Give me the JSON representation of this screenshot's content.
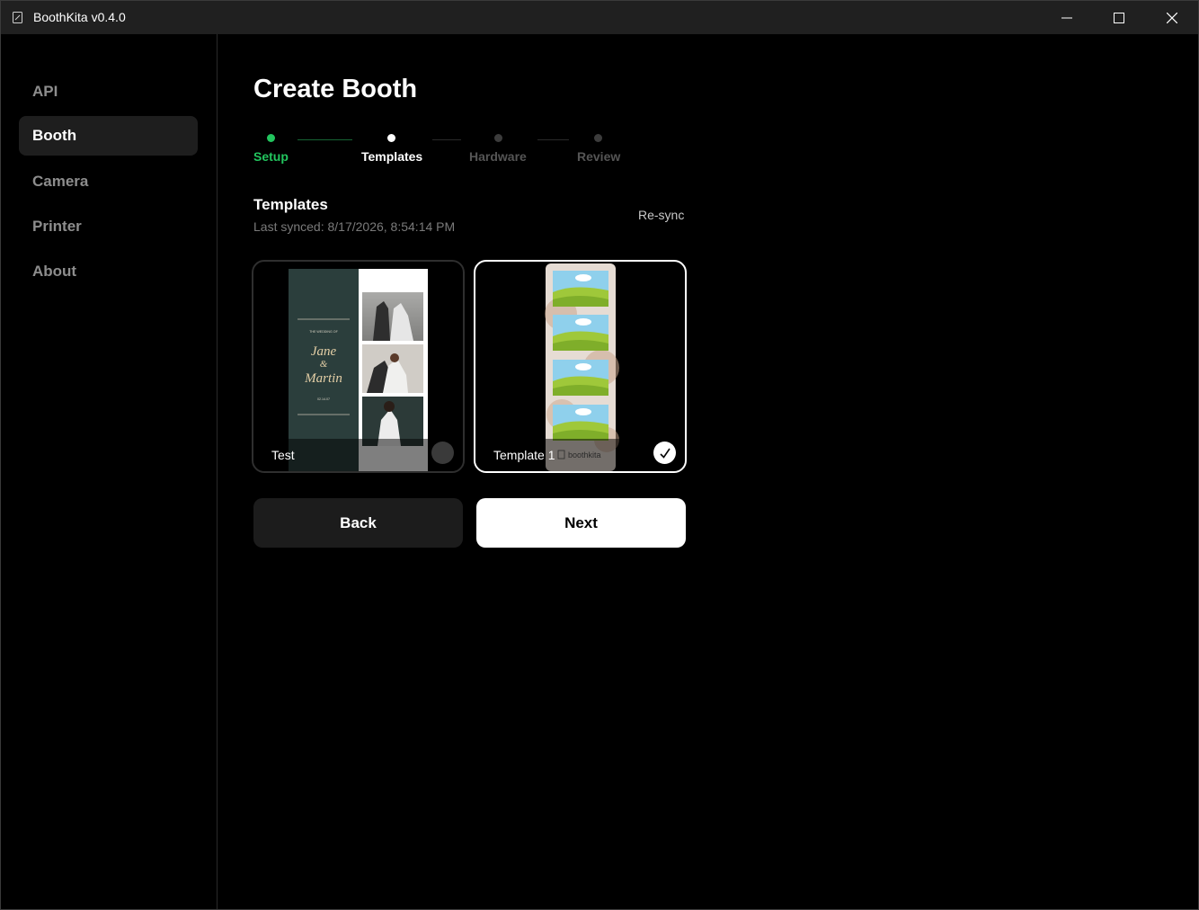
{
  "window": {
    "title": "BoothKita v0.4.0",
    "controls": [
      "minimize-icon",
      "maximize-icon",
      "close-icon"
    ]
  },
  "sidebar": {
    "items": [
      {
        "label": "API",
        "active": false
      },
      {
        "label": "Booth",
        "active": true
      },
      {
        "label": "Camera",
        "active": false
      },
      {
        "label": "Printer",
        "active": false
      },
      {
        "label": "About",
        "active": false
      }
    ]
  },
  "page": {
    "title": "Create Booth"
  },
  "stepper": {
    "steps": [
      {
        "label": "Setup",
        "state": "complete"
      },
      {
        "label": "Templates",
        "state": "current"
      },
      {
        "label": "Hardware",
        "state": "upcoming"
      },
      {
        "label": "Review",
        "state": "upcoming"
      }
    ]
  },
  "templates": {
    "title": "Templates",
    "last_synced": "Last synced: 8/17/2026, 8:54:14 PM",
    "resync_label": "Re-sync",
    "cards": [
      {
        "name": "Test",
        "selected": false,
        "preview": {
          "small_text": "THE WEDDING OF",
          "script_name_1": "Jane",
          "script_amp": "&",
          "script_name_2": "Martin",
          "date": "02.14.07"
        }
      },
      {
        "name": "Template 1",
        "selected": true,
        "preview": {
          "brand": "boothkita"
        }
      }
    ]
  },
  "actions": {
    "back_label": "Back",
    "next_label": "Next"
  },
  "colors": {
    "accent_green": "#22c55e",
    "titlebar_bg": "#202020",
    "sidebar_active_bg": "#1e1e1e",
    "card_teal": "#2b3e3c"
  }
}
